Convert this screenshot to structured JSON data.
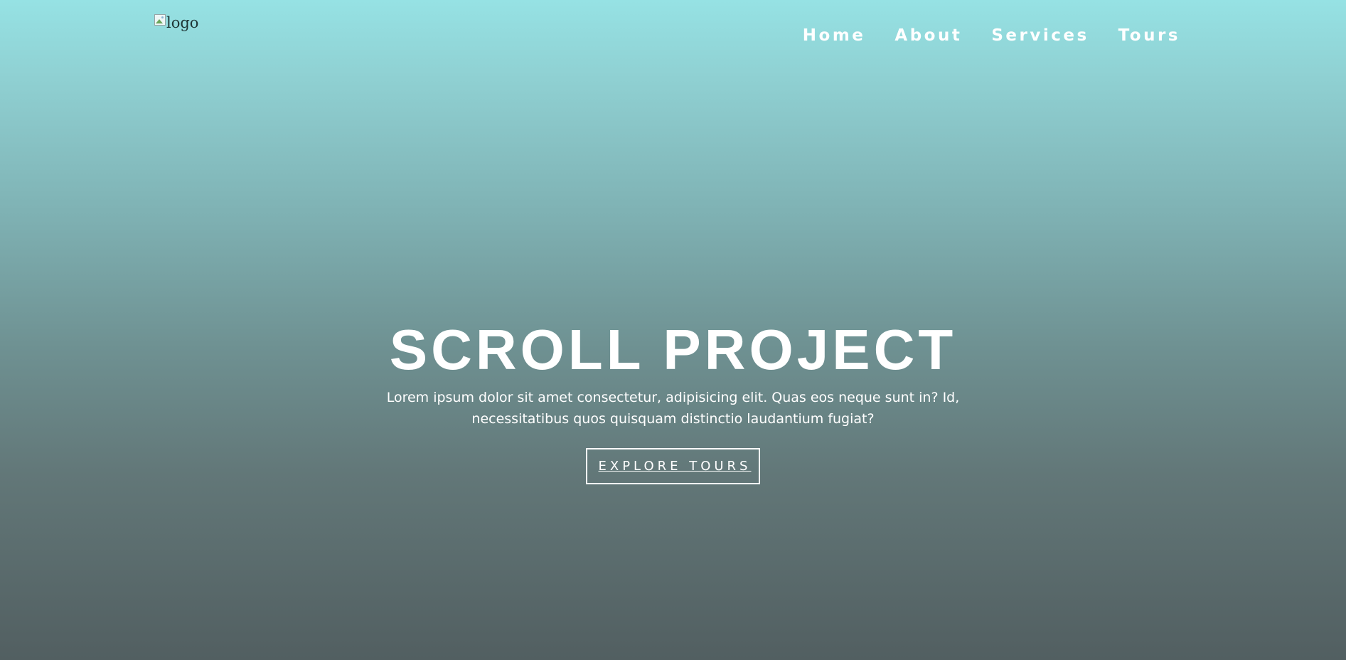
{
  "logo": {
    "alt_text": "logo",
    "icon": "broken-image-icon"
  },
  "nav": {
    "items": [
      {
        "label": "Home"
      },
      {
        "label": "About"
      },
      {
        "label": "Services"
      },
      {
        "label": "Tours"
      }
    ]
  },
  "banner": {
    "title": "SCROLL PROJECT",
    "description": "Lorem ipsum dolor sit amet consectetur, adipisicing elit. Quas eos neque sunt in? Id, necessitatibus quos quisquam distinctio laudantium fugiat?",
    "button_label": "EXPLORE TOURS"
  },
  "colors": {
    "gradient_top": "#96e2e4",
    "gradient_bottom": "#525f61",
    "text": "#ffffff"
  }
}
